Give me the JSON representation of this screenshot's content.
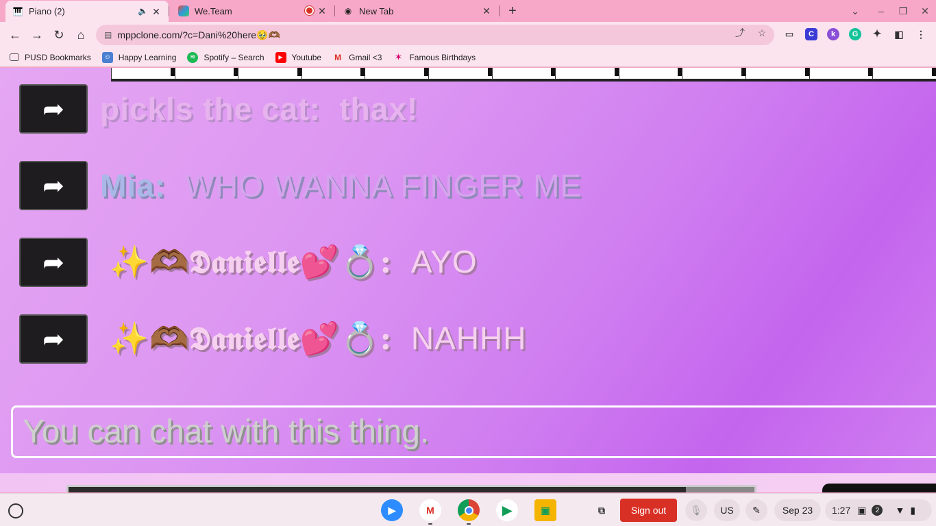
{
  "browser": {
    "tabs": [
      {
        "title": "Piano (2)",
        "icon": "piano-icon",
        "audio": true
      },
      {
        "title": "We.Team",
        "icon": "weteam-icon",
        "recording": true
      },
      {
        "title": "New Tab",
        "icon": "chrome-icon"
      }
    ],
    "url": "mppclone.com/?c=Dani%20here🥹🫶🏾",
    "bookmarks": [
      {
        "label": "PUSD Bookmarks",
        "icon": "folder-icon"
      },
      {
        "label": "Happy Learning",
        "icon": "happy-learning-icon"
      },
      {
        "label": "Spotify – Search",
        "icon": "spotify-icon"
      },
      {
        "label": "Youtube",
        "icon": "youtube-icon"
      },
      {
        "label": "Gmail <3",
        "icon": "gmail-icon"
      },
      {
        "label": "Famous Birthdays",
        "icon": "star-icon"
      }
    ],
    "extensions": [
      "cast-icon",
      "c-extension-icon",
      "k-extension-icon",
      "grammarly-icon",
      "puzzle-icon",
      "sidepanel-icon",
      "menu-icon"
    ]
  },
  "chat": {
    "messages": [
      {
        "name": "pickls the cat:",
        "text": "thax!"
      },
      {
        "name": "Mia:",
        "text": "WHO WANNA FINGER ME"
      },
      {
        "name": "✨🫶🏾𝕯𝖆𝖓𝖎𝖊𝖑𝖑𝖊💕💍:",
        "text": "AYO"
      },
      {
        "name": "✨🫶🏾𝕯𝖆𝖓𝖎𝖊𝖑𝖑𝖊💕💍:",
        "text": "NAHHH"
      }
    ],
    "input_placeholder": "You can chat with this thing.",
    "progress": 0.9
  },
  "shelf": {
    "apps": [
      "zoom-icon",
      "gmail-icon",
      "chrome-icon",
      "play-store-icon",
      "classroom-icon"
    ],
    "sign_out": "Sign out",
    "keyboard": "US",
    "date": "Sep 23",
    "time": "1:27",
    "notifications": "2"
  }
}
